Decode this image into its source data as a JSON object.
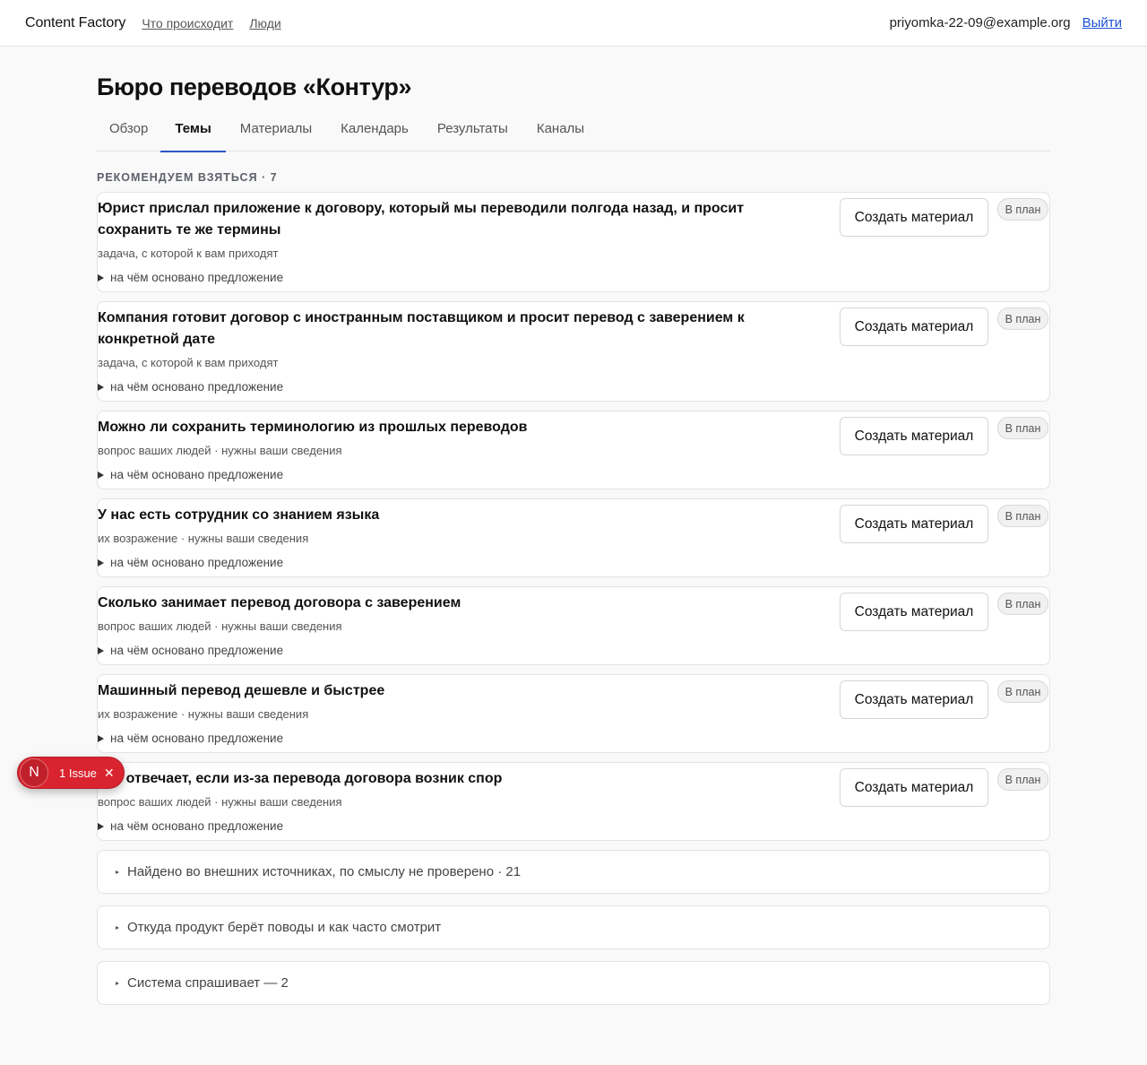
{
  "header": {
    "brand": "Content Factory",
    "nav": [
      "Что происходит",
      "Люди"
    ],
    "user_email": "priyomka-22-09@example.org",
    "logout": "Выйти"
  },
  "page": {
    "title": "Бюро переводов «Контур»",
    "tabs": [
      "Обзор",
      "Темы",
      "Материалы",
      "Календарь",
      "Результаты",
      "Каналы"
    ],
    "active_tab": "Темы"
  },
  "recommended": {
    "label": "РЕКОМЕНДУЕМ ВЗЯТЬСЯ · 7",
    "create_label": "Создать материал",
    "plan_label": "В план",
    "toggle_label": "на чём основано предложение",
    "items": [
      {
        "title": "Юрист прислал приложение к договору, который мы переводили полгода назад, и просит сохранить те же термины",
        "meta": "задача, с которой к вам приходят"
      },
      {
        "title": "Компания готовит договор с иностранным поставщиком и просит перевод с заверением к конкретной дате",
        "meta": "задача, с которой к вам приходят"
      },
      {
        "title": "Можно ли сохранить терминологию из прошлых переводов",
        "meta": "вопрос ваших людей · нужны ваши сведения"
      },
      {
        "title": "У нас есть сотрудник со знанием языка",
        "meta": "их возражение · нужны ваши сведения"
      },
      {
        "title": "Сколько занимает перевод договора с заверением",
        "meta": "вопрос ваших людей · нужны ваши сведения"
      },
      {
        "title": "Машинный перевод дешевле и быстрее",
        "meta": "их возражение · нужны ваши сведения"
      },
      {
        "title": "Кто отвечает, если из-за перевода договора возник спор",
        "meta": "вопрос ваших людей · нужны ваши сведения"
      }
    ]
  },
  "collapsibles": [
    "Найдено во внешних источниках, по смыслу не проверено · 21",
    "Откуда продукт берёт поводы и как часто смотрит",
    "Система спрашивает — 2"
  ],
  "issue_badge": {
    "logo": "N",
    "text": "1 Issue",
    "close_icon": "close-icon"
  }
}
